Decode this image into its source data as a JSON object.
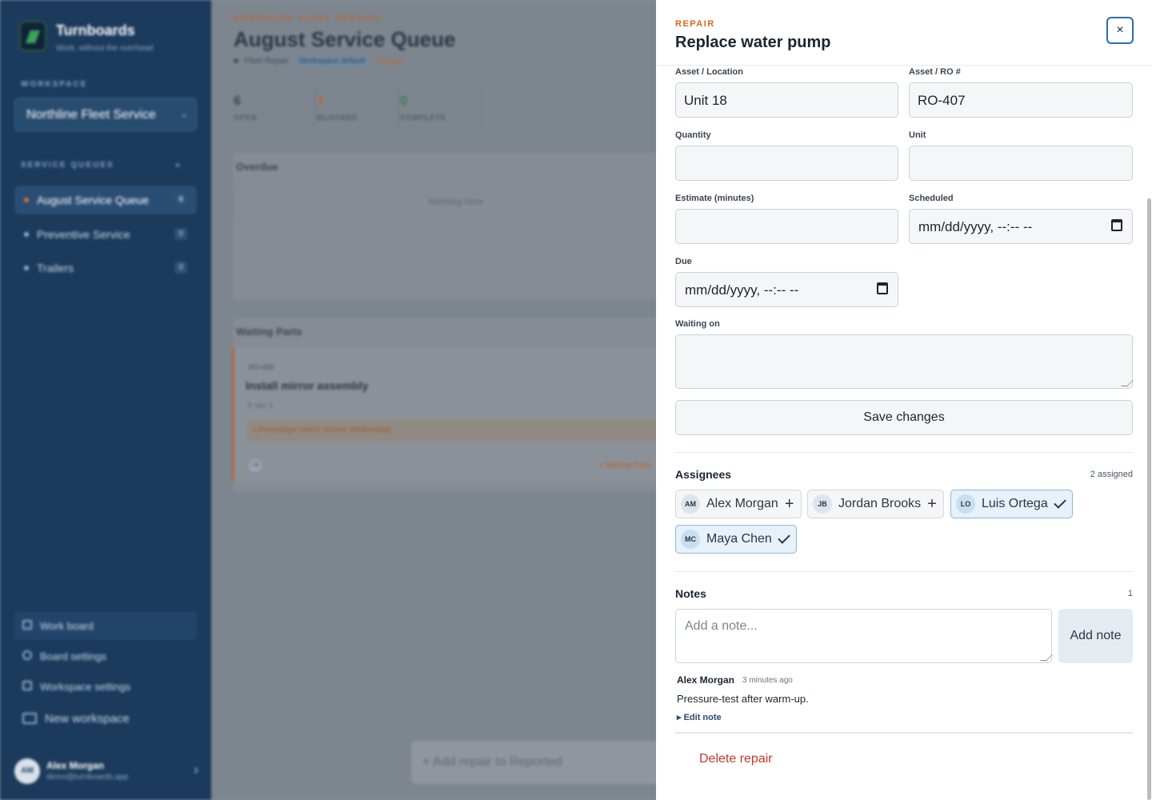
{
  "sidebar": {
    "brand_name": "Turnboards",
    "brand_tagline": "Work, without the overhead",
    "workspace_label": "WORKSPACE",
    "workspace_value": "Northline Fleet Service",
    "queues_label": "SERVICE QUEUES",
    "queues": [
      {
        "label": "August Service Queue",
        "count": "6"
      },
      {
        "label": "Preventive Service",
        "count": "0"
      },
      {
        "label": "Trailers",
        "count": "0"
      }
    ],
    "nav": [
      {
        "label": "Work board"
      },
      {
        "label": "Board settings"
      },
      {
        "label": "Workspace settings"
      },
      {
        "label": "New workspace"
      }
    ],
    "user": {
      "initials": "AM",
      "name": "Alex Morgan",
      "email": "demo@turnboards.app"
    }
  },
  "main": {
    "org": "NORTHLINE FLEET SERVICE",
    "title": "August Service Queue",
    "meta_type": "Fleet Repair",
    "meta_tag": "Workspace default",
    "meta_change": "Change",
    "stats": [
      {
        "value": "6",
        "label": "OPEN"
      },
      {
        "value": "1",
        "label": "BLOCKED"
      },
      {
        "value": "0",
        "label": "COMPLETE"
      }
    ],
    "overdue_title": "Overdue",
    "overdue_empty": "Nothing here",
    "waiting_title": "Waiting Parts",
    "card": {
      "ro": "RO-403",
      "title": "Install mirror assembly",
      "location": "Van 3",
      "warning": "Passenger mirror arrives Wednesday",
      "assignee": "LB",
      "status": "Waiting Parts"
    },
    "add_repair": "Add repair to Reported"
  },
  "drawer": {
    "kicker": "REPAIR",
    "title": "Replace water pump",
    "close_glyph": "×",
    "fields": {
      "asset_location": {
        "label": "Asset / Location",
        "value": "Unit 18"
      },
      "asset_ro": {
        "label": "Asset / RO #",
        "value": "RO-407"
      },
      "quantity": {
        "label": "Quantity",
        "value": ""
      },
      "unit": {
        "label": "Unit",
        "value": ""
      },
      "estimate": {
        "label": "Estimate (minutes)",
        "value": ""
      },
      "scheduled": {
        "label": "Scheduled",
        "value": "mm/dd/yyyy, --:-- --"
      },
      "due": {
        "label": "Due",
        "value": "mm/dd/yyyy, --:-- --"
      },
      "waiting_on": {
        "label": "Waiting on",
        "value": ""
      }
    },
    "save_label": "Save changes",
    "assignees": {
      "title": "Assignees",
      "count": "2 assigned",
      "people": [
        {
          "initials": "AM",
          "name": "Alex Morgan",
          "assigned": false
        },
        {
          "initials": "JB",
          "name": "Jordan Brooks",
          "assigned": false
        },
        {
          "initials": "LO",
          "name": "Luis Ortega",
          "assigned": true
        },
        {
          "initials": "MC",
          "name": "Maya Chen",
          "assigned": true
        }
      ]
    },
    "notes": {
      "title": "Notes",
      "count": "1",
      "placeholder": "Add a note...",
      "add_label": "Add note",
      "items": [
        {
          "author": "Alex Morgan",
          "time": "3 minutes ago",
          "body": "Pressure-test after warm-up.",
          "edit_label": "▸ Edit note"
        }
      ]
    },
    "delete_label": "Delete repair"
  },
  "colors": {
    "accent": "#d9641e",
    "focus": "#2a6db0",
    "danger": "#c0392b",
    "sidebar": "#1b3a5c"
  }
}
